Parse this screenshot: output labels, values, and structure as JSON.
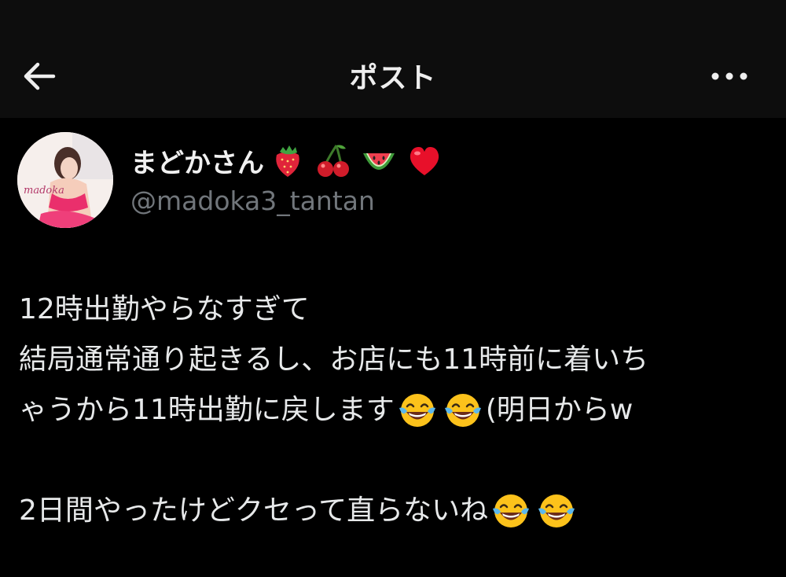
{
  "header": {
    "title": "ポスト",
    "back_icon": "arrow-left-icon",
    "more_icon": "more-horizontal-icon"
  },
  "author": {
    "display_name": "まどかさん",
    "name_emojis": [
      "strawberry-icon",
      "cherries-icon",
      "watermelon-icon",
      "red-heart-icon"
    ],
    "handle": "@madoka3_tantan",
    "avatar_watermark": "madoka"
  },
  "post": {
    "line1": "12時出勤やらなすぎて",
    "line2": "結局通常通り起きるし、お店にも11時前に着いち",
    "line3_text": "ゃうから11時出勤に戻します",
    "line3_suffix": "(明日からw",
    "line4_text": "2日間やったけどクセって直らないね",
    "emoji": "face-with-tears-of-joy-icon"
  },
  "colors": {
    "background": "#000000",
    "header_background": "#0d0d0d",
    "text": "#e7e9ea",
    "secondary_text": "#71767b"
  }
}
